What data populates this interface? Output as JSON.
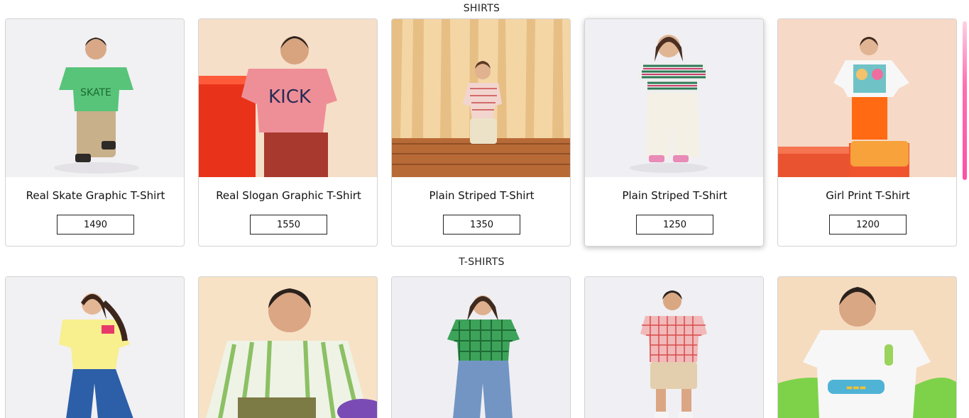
{
  "sections": [
    {
      "title": "SHIRTS",
      "products": [
        {
          "name": "Real Skate Graphic T-Shirt",
          "price": "1490"
        },
        {
          "name": "Real Slogan Graphic T-Shirt",
          "price": "1550"
        },
        {
          "name": "Plain Striped T-Shirt",
          "price": "1350"
        },
        {
          "name": "Plain Striped T-Shirt",
          "price": "1250"
        },
        {
          "name": "Girl Print T-Shirt",
          "price": "1200"
        }
      ]
    },
    {
      "title": "T-SHIRTS",
      "products": [
        {
          "name": "",
          "price": ""
        },
        {
          "name": "",
          "price": ""
        },
        {
          "name": "",
          "price": ""
        },
        {
          "name": "",
          "price": ""
        },
        {
          "name": "",
          "price": ""
        }
      ]
    }
  ],
  "colors": {
    "accent_scrollbar": "#ff4fa3",
    "card_border": "#d3d3d3"
  }
}
